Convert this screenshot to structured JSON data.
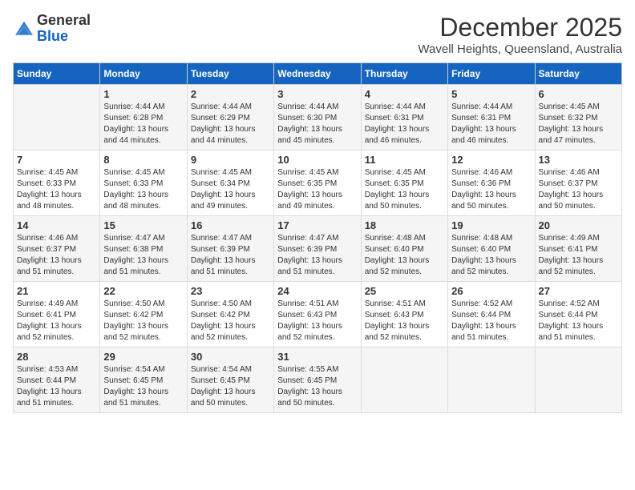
{
  "header": {
    "logo": {
      "general": "General",
      "blue": "Blue"
    },
    "title": "December 2025",
    "subtitle": "Wavell Heights, Queensland, Australia"
  },
  "days_of_week": [
    "Sunday",
    "Monday",
    "Tuesday",
    "Wednesday",
    "Thursday",
    "Friday",
    "Saturday"
  ],
  "weeks": [
    [
      {
        "day": "",
        "info": ""
      },
      {
        "day": "1",
        "info": "Sunrise: 4:44 AM\nSunset: 6:28 PM\nDaylight: 13 hours\nand 44 minutes."
      },
      {
        "day": "2",
        "info": "Sunrise: 4:44 AM\nSunset: 6:29 PM\nDaylight: 13 hours\nand 44 minutes."
      },
      {
        "day": "3",
        "info": "Sunrise: 4:44 AM\nSunset: 6:30 PM\nDaylight: 13 hours\nand 45 minutes."
      },
      {
        "day": "4",
        "info": "Sunrise: 4:44 AM\nSunset: 6:31 PM\nDaylight: 13 hours\nand 46 minutes."
      },
      {
        "day": "5",
        "info": "Sunrise: 4:44 AM\nSunset: 6:31 PM\nDaylight: 13 hours\nand 46 minutes."
      },
      {
        "day": "6",
        "info": "Sunrise: 4:45 AM\nSunset: 6:32 PM\nDaylight: 13 hours\nand 47 minutes."
      }
    ],
    [
      {
        "day": "7",
        "info": "Sunrise: 4:45 AM\nSunset: 6:33 PM\nDaylight: 13 hours\nand 48 minutes."
      },
      {
        "day": "8",
        "info": "Sunrise: 4:45 AM\nSunset: 6:33 PM\nDaylight: 13 hours\nand 48 minutes."
      },
      {
        "day": "9",
        "info": "Sunrise: 4:45 AM\nSunset: 6:34 PM\nDaylight: 13 hours\nand 49 minutes."
      },
      {
        "day": "10",
        "info": "Sunrise: 4:45 AM\nSunset: 6:35 PM\nDaylight: 13 hours\nand 49 minutes."
      },
      {
        "day": "11",
        "info": "Sunrise: 4:45 AM\nSunset: 6:35 PM\nDaylight: 13 hours\nand 50 minutes."
      },
      {
        "day": "12",
        "info": "Sunrise: 4:46 AM\nSunset: 6:36 PM\nDaylight: 13 hours\nand 50 minutes."
      },
      {
        "day": "13",
        "info": "Sunrise: 4:46 AM\nSunset: 6:37 PM\nDaylight: 13 hours\nand 50 minutes."
      }
    ],
    [
      {
        "day": "14",
        "info": "Sunrise: 4:46 AM\nSunset: 6:37 PM\nDaylight: 13 hours\nand 51 minutes."
      },
      {
        "day": "15",
        "info": "Sunrise: 4:47 AM\nSunset: 6:38 PM\nDaylight: 13 hours\nand 51 minutes."
      },
      {
        "day": "16",
        "info": "Sunrise: 4:47 AM\nSunset: 6:39 PM\nDaylight: 13 hours\nand 51 minutes."
      },
      {
        "day": "17",
        "info": "Sunrise: 4:47 AM\nSunset: 6:39 PM\nDaylight: 13 hours\nand 51 minutes."
      },
      {
        "day": "18",
        "info": "Sunrise: 4:48 AM\nSunset: 6:40 PM\nDaylight: 13 hours\nand 52 minutes."
      },
      {
        "day": "19",
        "info": "Sunrise: 4:48 AM\nSunset: 6:40 PM\nDaylight: 13 hours\nand 52 minutes."
      },
      {
        "day": "20",
        "info": "Sunrise: 4:49 AM\nSunset: 6:41 PM\nDaylight: 13 hours\nand 52 minutes."
      }
    ],
    [
      {
        "day": "21",
        "info": "Sunrise: 4:49 AM\nSunset: 6:41 PM\nDaylight: 13 hours\nand 52 minutes."
      },
      {
        "day": "22",
        "info": "Sunrise: 4:50 AM\nSunset: 6:42 PM\nDaylight: 13 hours\nand 52 minutes."
      },
      {
        "day": "23",
        "info": "Sunrise: 4:50 AM\nSunset: 6:42 PM\nDaylight: 13 hours\nand 52 minutes."
      },
      {
        "day": "24",
        "info": "Sunrise: 4:51 AM\nSunset: 6:43 PM\nDaylight: 13 hours\nand 52 minutes."
      },
      {
        "day": "25",
        "info": "Sunrise: 4:51 AM\nSunset: 6:43 PM\nDaylight: 13 hours\nand 52 minutes."
      },
      {
        "day": "26",
        "info": "Sunrise: 4:52 AM\nSunset: 6:44 PM\nDaylight: 13 hours\nand 51 minutes."
      },
      {
        "day": "27",
        "info": "Sunrise: 4:52 AM\nSunset: 6:44 PM\nDaylight: 13 hours\nand 51 minutes."
      }
    ],
    [
      {
        "day": "28",
        "info": "Sunrise: 4:53 AM\nSunset: 6:44 PM\nDaylight: 13 hours\nand 51 minutes."
      },
      {
        "day": "29",
        "info": "Sunrise: 4:54 AM\nSunset: 6:45 PM\nDaylight: 13 hours\nand 51 minutes."
      },
      {
        "day": "30",
        "info": "Sunrise: 4:54 AM\nSunset: 6:45 PM\nDaylight: 13 hours\nand 50 minutes."
      },
      {
        "day": "31",
        "info": "Sunrise: 4:55 AM\nSunset: 6:45 PM\nDaylight: 13 hours\nand 50 minutes."
      },
      {
        "day": "",
        "info": ""
      },
      {
        "day": "",
        "info": ""
      },
      {
        "day": "",
        "info": ""
      }
    ]
  ]
}
